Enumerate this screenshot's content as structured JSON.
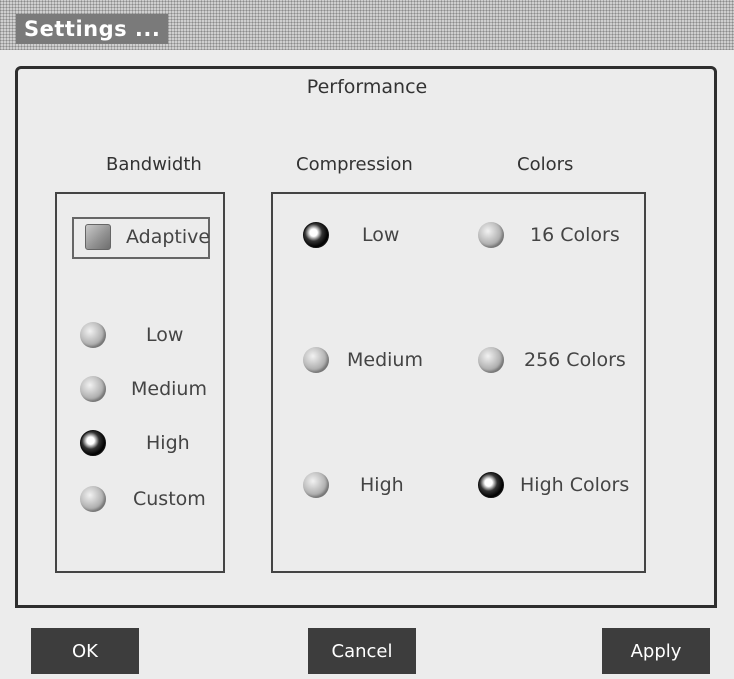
{
  "window": {
    "title": "Settings ..."
  },
  "panel": {
    "title": "Performance"
  },
  "bandwidth": {
    "label": "Bandwidth",
    "adaptive": {
      "label": "Adaptive",
      "checked": false
    },
    "options": [
      {
        "label": "Low",
        "selected": false
      },
      {
        "label": "Medium",
        "selected": false
      },
      {
        "label": "High",
        "selected": true
      },
      {
        "label": "Custom",
        "selected": false
      }
    ]
  },
  "compression": {
    "label": "Compression",
    "options": [
      {
        "label": "Low",
        "selected": true
      },
      {
        "label": "Medium",
        "selected": false
      },
      {
        "label": "High",
        "selected": false
      }
    ]
  },
  "colors": {
    "label": "Colors",
    "options": [
      {
        "label": "16 Colors",
        "selected": false
      },
      {
        "label": "256 Colors",
        "selected": false
      },
      {
        "label": "High Colors",
        "selected": true
      }
    ]
  },
  "buttons": {
    "ok": "OK",
    "cancel": "Cancel",
    "apply": "Apply"
  },
  "colors_theme": {
    "button_bg": "#3d3d3d",
    "title_bg": "#7a7a7a",
    "panel_bg": "#ececec"
  }
}
